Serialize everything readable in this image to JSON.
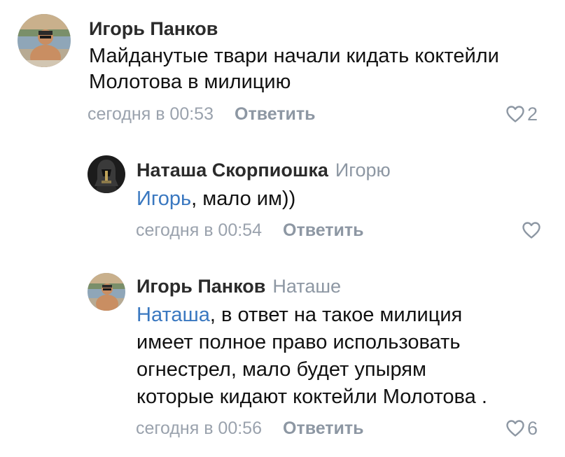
{
  "comments": [
    {
      "author": "Игорь Панков",
      "reply_to": "",
      "mention": "",
      "lines": [
        "Майданутые твари начали кидать коктейли",
        "Молотова в милицию"
      ],
      "time": "сегодня в 00:53",
      "reply_label": "Ответить",
      "likes": "2"
    },
    {
      "author": "Наташа Скорпиошка",
      "reply_to": "Игорю",
      "mention": "Игорь",
      "lines": [
        ", мало им))"
      ],
      "time": "сегодня в 00:54",
      "reply_label": "Ответить",
      "likes": ""
    },
    {
      "author": "Игорь Панков",
      "reply_to": "Наташе",
      "mention": "Наташа",
      "lines": [
        ", в ответ  на такое милиция",
        "имеет полное право  использовать",
        "огнестрел,  мало будет упырям",
        "которые кидают коктейли  Молотова ."
      ],
      "time": "сегодня в 00:56",
      "reply_label": "Ответить",
      "likes": "6"
    }
  ],
  "icons": {
    "like": "heart-outline-icon"
  },
  "colors": {
    "link": "#3a78c0",
    "secondary": "#8d97a3",
    "author": "#2b2b2b"
  }
}
